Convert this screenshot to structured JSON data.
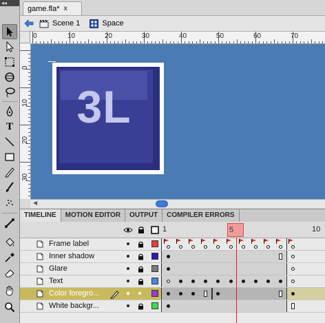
{
  "document": {
    "tab_title": "game.fla*",
    "close_glyph": "x"
  },
  "edit_bar": {
    "scene_label": "Scene 1",
    "symbol_label": "Space"
  },
  "rulers": {
    "top": [
      "0",
      "10",
      "20",
      "30",
      "40",
      "50",
      "60",
      "70"
    ],
    "left": [
      "0",
      "10",
      "20",
      "30"
    ]
  },
  "stage": {
    "symbol_text": "3L",
    "stage_color": "#4a7bb5"
  },
  "panel_tabs": [
    "TIMELINE",
    "MOTION EDITOR",
    "OUTPUT",
    "COMPILER ERRORS"
  ],
  "timeline": {
    "frame_numbers": [
      "1",
      "5",
      "10"
    ],
    "current_frame": "5",
    "layers": [
      {
        "name": "Frame label",
        "color": "#ef3b3b",
        "selected": false
      },
      {
        "name": "Inner shadow",
        "color": "#2a1bb0",
        "selected": false
      },
      {
        "name": "Glare",
        "color": "#7a7a7a",
        "selected": false
      },
      {
        "name": "Text",
        "color": "#4a84e8",
        "selected": false
      },
      {
        "name": "Color foregro...",
        "color": "#9b3ad1",
        "selected": true
      },
      {
        "name": "White backgr...",
        "color": "#3ee04a",
        "selected": false
      }
    ]
  }
}
